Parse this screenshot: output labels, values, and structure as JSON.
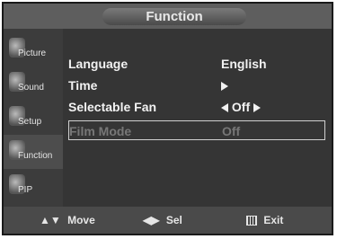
{
  "title": "Function",
  "sidebar": {
    "items": [
      {
        "label": "Picture",
        "icon": "picture-icon",
        "active": false
      },
      {
        "label": "Sound",
        "icon": "sound-icon",
        "active": false
      },
      {
        "label": "Setup",
        "icon": "setup-icon",
        "active": false
      },
      {
        "label": "Function",
        "icon": "function-icon",
        "active": true
      },
      {
        "label": "PIP",
        "icon": "pip-icon",
        "active": false
      }
    ]
  },
  "menu": {
    "language": {
      "label": "Language",
      "value": "English"
    },
    "time": {
      "label": "Time"
    },
    "selectable_fan": {
      "label": "Selectable Fan",
      "value": "Off"
    },
    "film_mode": {
      "label": "Film Mode",
      "value": "Off"
    }
  },
  "footer": {
    "move": "Move",
    "sel": "Sel",
    "exit": "Exit"
  }
}
